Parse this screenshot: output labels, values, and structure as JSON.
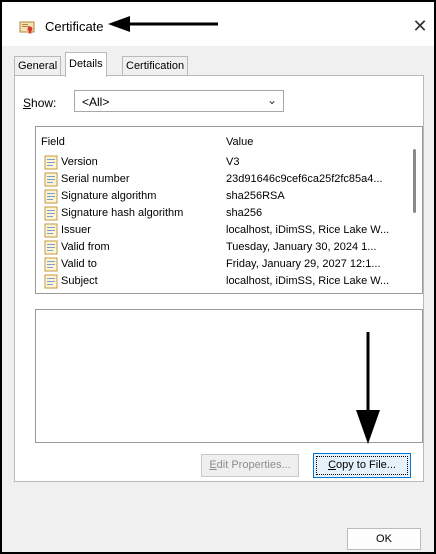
{
  "window": {
    "title": "Certificate",
    "close_glyph": "✕"
  },
  "tabs": [
    {
      "label": "General"
    },
    {
      "label": "Details",
      "active": true
    },
    {
      "label": "Certification Path"
    }
  ],
  "show": {
    "label_prefix": "S",
    "label_rest": "how:",
    "selected": "<All>",
    "chevron": "⌄"
  },
  "fields_list": {
    "columns": [
      "Field",
      "Value"
    ],
    "rows": [
      {
        "field": "Version",
        "value": "V3"
      },
      {
        "field": "Serial number",
        "value": "23d91646c9cef6ca25f2fc85a4..."
      },
      {
        "field": "Signature algorithm",
        "value": "sha256RSA"
      },
      {
        "field": "Signature hash algorithm",
        "value": "sha256"
      },
      {
        "field": "Issuer",
        "value": "localhost, iDimSS, Rice Lake W..."
      },
      {
        "field": "Valid from",
        "value": "Tuesday, January 30, 2024 1..."
      },
      {
        "field": "Valid to",
        "value": "Friday, January 29, 2027 12:1..."
      },
      {
        "field": "Subject",
        "value": "localhost, iDimSS, Rice Lake W..."
      }
    ]
  },
  "buttons": {
    "edit_properties_accel": "E",
    "edit_properties_rest": "dit Properties...",
    "copy_to_file_accel": "C",
    "copy_to_file_rest": "opy to File...",
    "ok": "OK"
  },
  "annotations": {
    "arrow_color": "#000000"
  }
}
